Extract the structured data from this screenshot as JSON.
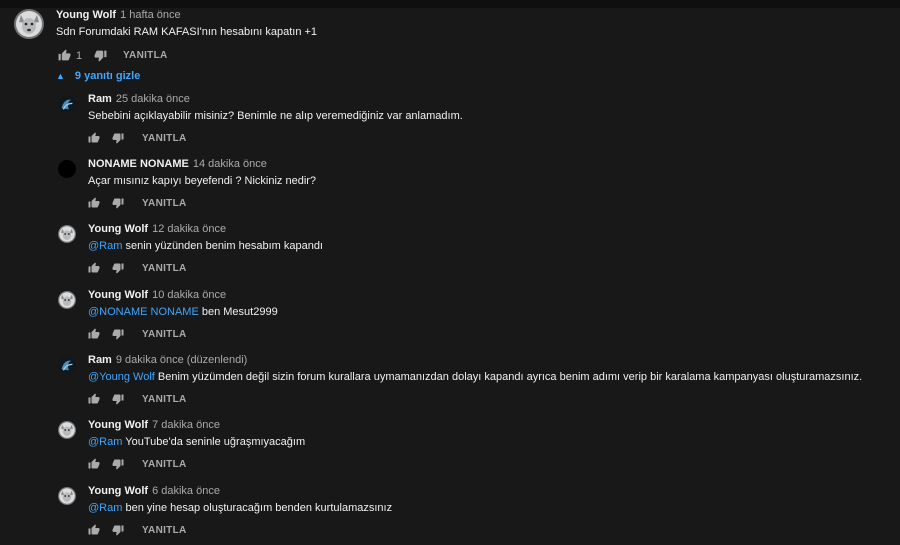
{
  "colors": {
    "background": "#181818",
    "text": "#f1f1f1",
    "secondary": "#aaaaaa",
    "link": "#3ea6ff"
  },
  "top_comment": {
    "author": "Young Wolf",
    "time": "1 hafta önce",
    "text": "Sdn Forumdaki RAM KAFASI'nın hesabını kapatın +1",
    "like_count": "1",
    "reply_label": "YANITLA",
    "avatar": "wolf-avatar"
  },
  "replies_toggle": {
    "icon": "chevron-up-icon",
    "label": "9 yanıtı gizle"
  },
  "replies": [
    {
      "author": "Ram",
      "time": "25 dakika önce",
      "mention": "",
      "text": "Sebebini açıklayabilir misiniz? Benimle ne alıp veremediğiniz var anlamadım.",
      "reply_label": "YANITLA",
      "avatar": "ram-avatar"
    },
    {
      "author": "NONAME NONAME",
      "time": "14 dakika önce",
      "mention": "",
      "text": "Açar mısınız kapıyı beyefendi ? Nickiniz  nedir?",
      "reply_label": "YANITLA",
      "avatar": "black-avatar"
    },
    {
      "author": "Young Wolf",
      "time": "12 dakika önce",
      "mention": "@Ram",
      "text": "senin yüzünden benim hesabım kapandı",
      "reply_label": "YANITLA",
      "avatar": "wolf-avatar"
    },
    {
      "author": "Young Wolf",
      "time": "10 dakika önce",
      "mention": "@NONAME NONAME",
      "text": "ben Mesut2999",
      "reply_label": "YANITLA",
      "avatar": "wolf-avatar"
    },
    {
      "author": "Ram",
      "time": "9 dakika önce (düzenlendi)",
      "mention": "@Young Wolf",
      "text": "Benim yüzümden değil sizin forum kurallara uymamanızdan dolayı kapandı ayrıca benim adımı verip bir karalama kampanyası oluşturamazsınız.",
      "reply_label": "YANITLA",
      "avatar": "ram-avatar"
    },
    {
      "author": "Young Wolf",
      "time": "7 dakika önce",
      "mention": "@Ram",
      "text": "YouTube'da seninle uğraşmıyacağım",
      "reply_label": "YANITLA",
      "avatar": "wolf-avatar"
    },
    {
      "author": "Young Wolf",
      "time": "6 dakika önce",
      "mention": "@Ram",
      "text": "ben yine hesap oluşturacağım benden kurtulamazsınız",
      "reply_label": "YANITLA",
      "avatar": "wolf-avatar"
    }
  ]
}
